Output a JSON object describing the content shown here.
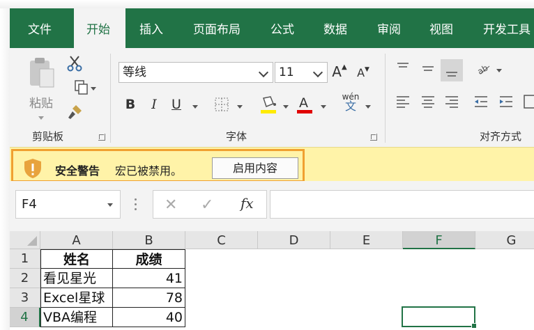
{
  "ribbon_tabs": [
    "文件",
    "开始",
    "插入",
    "页面布局",
    "公式",
    "数据",
    "审阅",
    "视图",
    "开发工具"
  ],
  "active_tab": "开始",
  "clipboard": {
    "paste_label": "粘贴",
    "group_label": "剪贴板"
  },
  "font": {
    "name": "等线",
    "size": "11",
    "group_label": "字体",
    "bold": "B",
    "italic": "I",
    "underline": "U",
    "phonetic_top": "wén",
    "phonetic_bottom": "文"
  },
  "alignment": {
    "group_label": "对齐方式"
  },
  "security_bar": {
    "title": "安全警告",
    "message": "宏已被禁用。",
    "button": "启用内容"
  },
  "formula_bar": {
    "name_box": "F4",
    "cancel": "✕",
    "enter": "✓",
    "fx": "fx",
    "formula": ""
  },
  "columns": [
    "A",
    "B",
    "C",
    "D",
    "E",
    "F",
    "G"
  ],
  "selected_column": "F",
  "rows": [
    "1",
    "2",
    "3",
    "4"
  ],
  "table": {
    "headers": [
      "姓名",
      "成绩"
    ],
    "data": [
      [
        "看见星光",
        "41"
      ],
      [
        "Excel星球",
        "78"
      ],
      [
        "VBA编程",
        "40"
      ]
    ]
  },
  "colors": {
    "excel_green": "#217346",
    "warning_yellow": "#fff3a8",
    "highlight_orange": "#f0a030"
  }
}
